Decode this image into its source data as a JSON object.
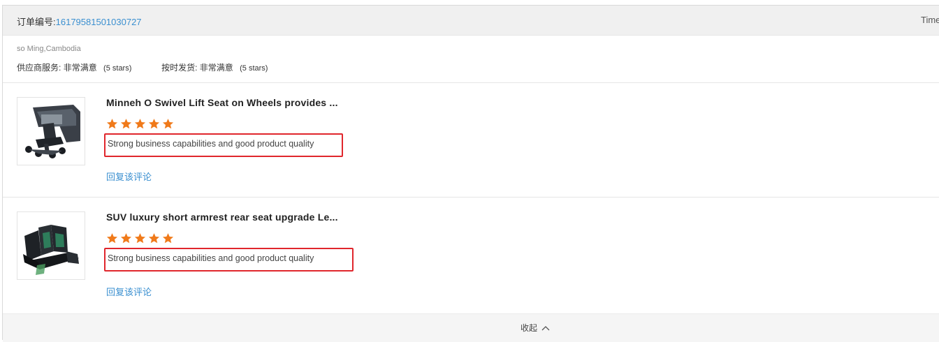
{
  "order": {
    "label": "订单编号:",
    "number": "16179581501030727",
    "time_label": "Time"
  },
  "buyer": "so Ming,Cambodia",
  "ratings": {
    "supplier_service_label": "供应商服务:",
    "supplier_service_value": "非常满意",
    "supplier_service_stars": "(5 stars)",
    "on_time_label": "按时发货:",
    "on_time_value": "非常满意",
    "on_time_stars": "(5 stars)"
  },
  "items": [
    {
      "title": "Minneh O Swivel Lift Seat on Wheels provides ...",
      "stars": 5,
      "review": "Strong business capabilities and good product quality",
      "reply_label": "回复该评论"
    },
    {
      "title": "SUV luxury short armrest rear seat upgrade Le...",
      "stars": 5,
      "review": "Strong business capabilities and good product quality",
      "reply_label": "回复该评论"
    }
  ],
  "footer": {
    "collapse_label": "收起"
  },
  "colors": {
    "link": "#3a8fd0",
    "star": "#f07a1a",
    "highlight": "#e0262c"
  }
}
